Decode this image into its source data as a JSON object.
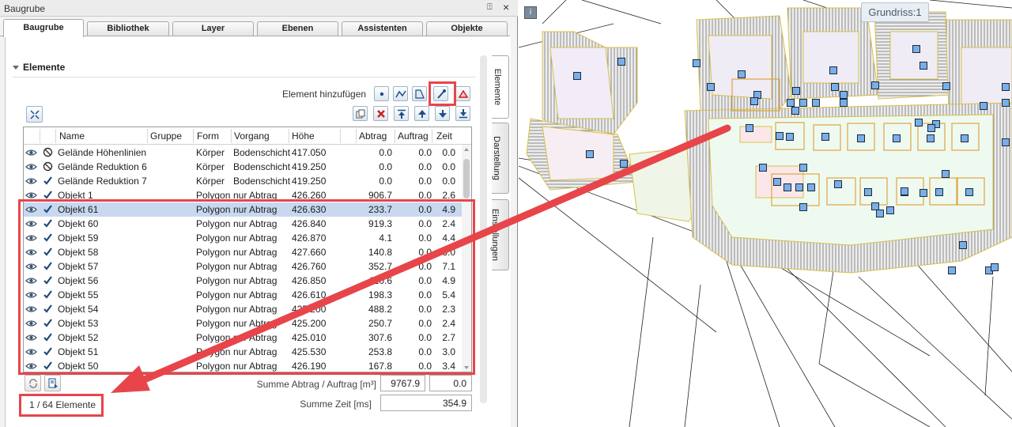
{
  "panel": {
    "title": "Baugrube",
    "pin_glyph": "⍐",
    "close_glyph": "×"
  },
  "tabs": [
    "Baugrube",
    "Bibliothek",
    "Layer",
    "Ebenen",
    "Assistenten",
    "Objekte"
  ],
  "side_tabs": [
    "Elemente",
    "Darstellung",
    "Einstellungen"
  ],
  "section": {
    "label": "Elemente"
  },
  "toolbar": {
    "add_label": "Element hinzufügen",
    "add_buttons": [
      "point-tool",
      "polyline-tool",
      "area-tool",
      "pipette-tool",
      "fill-tool"
    ],
    "action_buttons": [
      "copy",
      "delete",
      "move-top",
      "move-up",
      "move-down",
      "move-bottom"
    ]
  },
  "table": {
    "columns": [
      "Name",
      "Gruppe",
      "Form",
      "Vorgang",
      "Höhe",
      "Abtrag",
      "Auftrag",
      "Zeit"
    ],
    "rows": [
      {
        "name": "Gelände Höhenlinien",
        "gruppe": "",
        "form": "Körper",
        "vorgang": "Bodenschicht",
        "hoehe": "417.050",
        "abtrag": "0.0",
        "auftrag": "0.0",
        "zeit": "0.0",
        "status": "blocked",
        "selected": false
      },
      {
        "name": "Gelände Reduktion 6",
        "gruppe": "",
        "form": "Körper",
        "vorgang": "Bodenschicht",
        "hoehe": "419.250",
        "abtrag": "0.0",
        "auftrag": "0.0",
        "zeit": "0.0",
        "status": "blocked",
        "selected": false
      },
      {
        "name": "Gelände Reduktion 7",
        "gruppe": "",
        "form": "Körper",
        "vorgang": "Bodenschicht",
        "hoehe": "419.250",
        "abtrag": "0.0",
        "auftrag": "0.0",
        "zeit": "0.0",
        "status": "ok",
        "selected": false
      },
      {
        "name": "Objekt 1",
        "gruppe": "",
        "form": "Polygon",
        "vorgang": "nur Abtrag",
        "hoehe": "426.260",
        "abtrag": "906.7",
        "auftrag": "0.0",
        "zeit": "2.6",
        "status": "ok",
        "selected": false
      },
      {
        "name": "Objekt 61",
        "gruppe": "",
        "form": "Polygon",
        "vorgang": "nur Abtrag",
        "hoehe": "426.630",
        "abtrag": "233.7",
        "auftrag": "0.0",
        "zeit": "4.9",
        "status": "ok",
        "selected": true
      },
      {
        "name": "Objekt 60",
        "gruppe": "",
        "form": "Polygon",
        "vorgang": "nur Abtrag",
        "hoehe": "426.840",
        "abtrag": "919.3",
        "auftrag": "0.0",
        "zeit": "2.4",
        "status": "ok",
        "selected": false
      },
      {
        "name": "Objekt 59",
        "gruppe": "",
        "form": "Polygon",
        "vorgang": "nur Abtrag",
        "hoehe": "426.870",
        "abtrag": "4.1",
        "auftrag": "0.0",
        "zeit": "4.4",
        "status": "ok",
        "selected": false
      },
      {
        "name": "Objekt 58",
        "gruppe": "",
        "form": "Polygon",
        "vorgang": "nur Abtrag",
        "hoehe": "427.660",
        "abtrag": "140.8",
        "auftrag": "0.0",
        "zeit": "3.0",
        "status": "ok",
        "selected": false
      },
      {
        "name": "Objekt 57",
        "gruppe": "",
        "form": "Polygon",
        "vorgang": "nur Abtrag",
        "hoehe": "426.760",
        "abtrag": "352.7",
        "auftrag": "0.0",
        "zeit": "7.1",
        "status": "ok",
        "selected": false
      },
      {
        "name": "Objekt 56",
        "gruppe": "",
        "form": "Polygon",
        "vorgang": "nur Abtrag",
        "hoehe": "426.850",
        "abtrag": "110.6",
        "auftrag": "0.0",
        "zeit": "4.9",
        "status": "ok",
        "selected": false
      },
      {
        "name": "Objekt 55",
        "gruppe": "",
        "form": "Polygon",
        "vorgang": "nur Abtrag",
        "hoehe": "426.610",
        "abtrag": "198.3",
        "auftrag": "0.0",
        "zeit": "5.4",
        "status": "ok",
        "selected": false
      },
      {
        "name": "Objekt 54",
        "gruppe": "",
        "form": "Polygon",
        "vorgang": "nur Abtrag",
        "hoehe": "425.200",
        "abtrag": "488.2",
        "auftrag": "0.0",
        "zeit": "2.3",
        "status": "ok",
        "selected": false
      },
      {
        "name": "Objekt 53",
        "gruppe": "",
        "form": "Polygon",
        "vorgang": "nur Abtrag",
        "hoehe": "425.200",
        "abtrag": "250.7",
        "auftrag": "0.0",
        "zeit": "2.4",
        "status": "ok",
        "selected": false
      },
      {
        "name": "Objekt 52",
        "gruppe": "",
        "form": "Polygon",
        "vorgang": "nur Abtrag",
        "hoehe": "425.010",
        "abtrag": "307.6",
        "auftrag": "0.0",
        "zeit": "2.7",
        "status": "ok",
        "selected": false
      },
      {
        "name": "Objekt 51",
        "gruppe": "",
        "form": "Polygon",
        "vorgang": "nur Abtrag",
        "hoehe": "425.530",
        "abtrag": "253.8",
        "auftrag": "0.0",
        "zeit": "3.0",
        "status": "ok",
        "selected": false
      },
      {
        "name": "Objekt 50",
        "gruppe": "",
        "form": "Polygon",
        "vorgang": "nur Abtrag",
        "hoehe": "426.190",
        "abtrag": "167.8",
        "auftrag": "0.0",
        "zeit": "3.4",
        "status": "ok",
        "selected": false
      }
    ]
  },
  "summary": {
    "abtrag_auftrag_label": "Summe Abtrag / Auftrag [m³]",
    "abtrag_value": "9767.9",
    "auftrag_value": "0.0",
    "zeit_label": "Summe Zeit [ms]",
    "zeit_value": "354.9"
  },
  "status": {
    "text": "1 / 64 Elemente"
  },
  "canvas": {
    "view_label": "Grundriss:1",
    "corner_icon": "i"
  },
  "colors": {
    "highlight": "#e7454a",
    "selection": "#c7d8ef",
    "marker_fill": "#7aaee8",
    "outline": "#d8c04a"
  }
}
